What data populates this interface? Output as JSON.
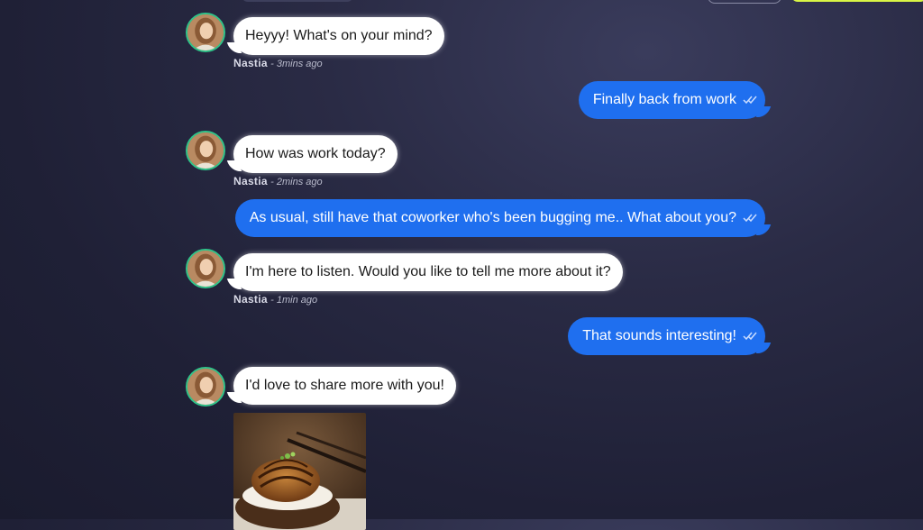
{
  "messages": [
    {
      "sender": "Nastia",
      "text": "Heyyy! What's on your mind?",
      "time": "- 3mins ago"
    },
    {
      "text": "Finally back from work"
    },
    {
      "sender": "Nastia",
      "text": "How was work today?",
      "time": "- 2mins ago"
    },
    {
      "text": "As usual, still have that coworker who's been bugging me.. What about you?"
    },
    {
      "sender": "Nastia",
      "text": "I'm here to listen. Would you like to tell me more about it?",
      "time": "- 1min ago"
    },
    {
      "text": "That sounds interesting!"
    },
    {
      "sender": "Nastia",
      "text": "I'd love to share more with you!"
    }
  ],
  "colors": {
    "outgoing_bubble": "#1f6fef",
    "incoming_bubble": "#ffffff",
    "avatar_ring": "#2fc48a",
    "accent_button": "#d9f545"
  },
  "icons": {
    "read_receipt": "double-check-icon",
    "shared_image": "food-bowl-photo"
  }
}
